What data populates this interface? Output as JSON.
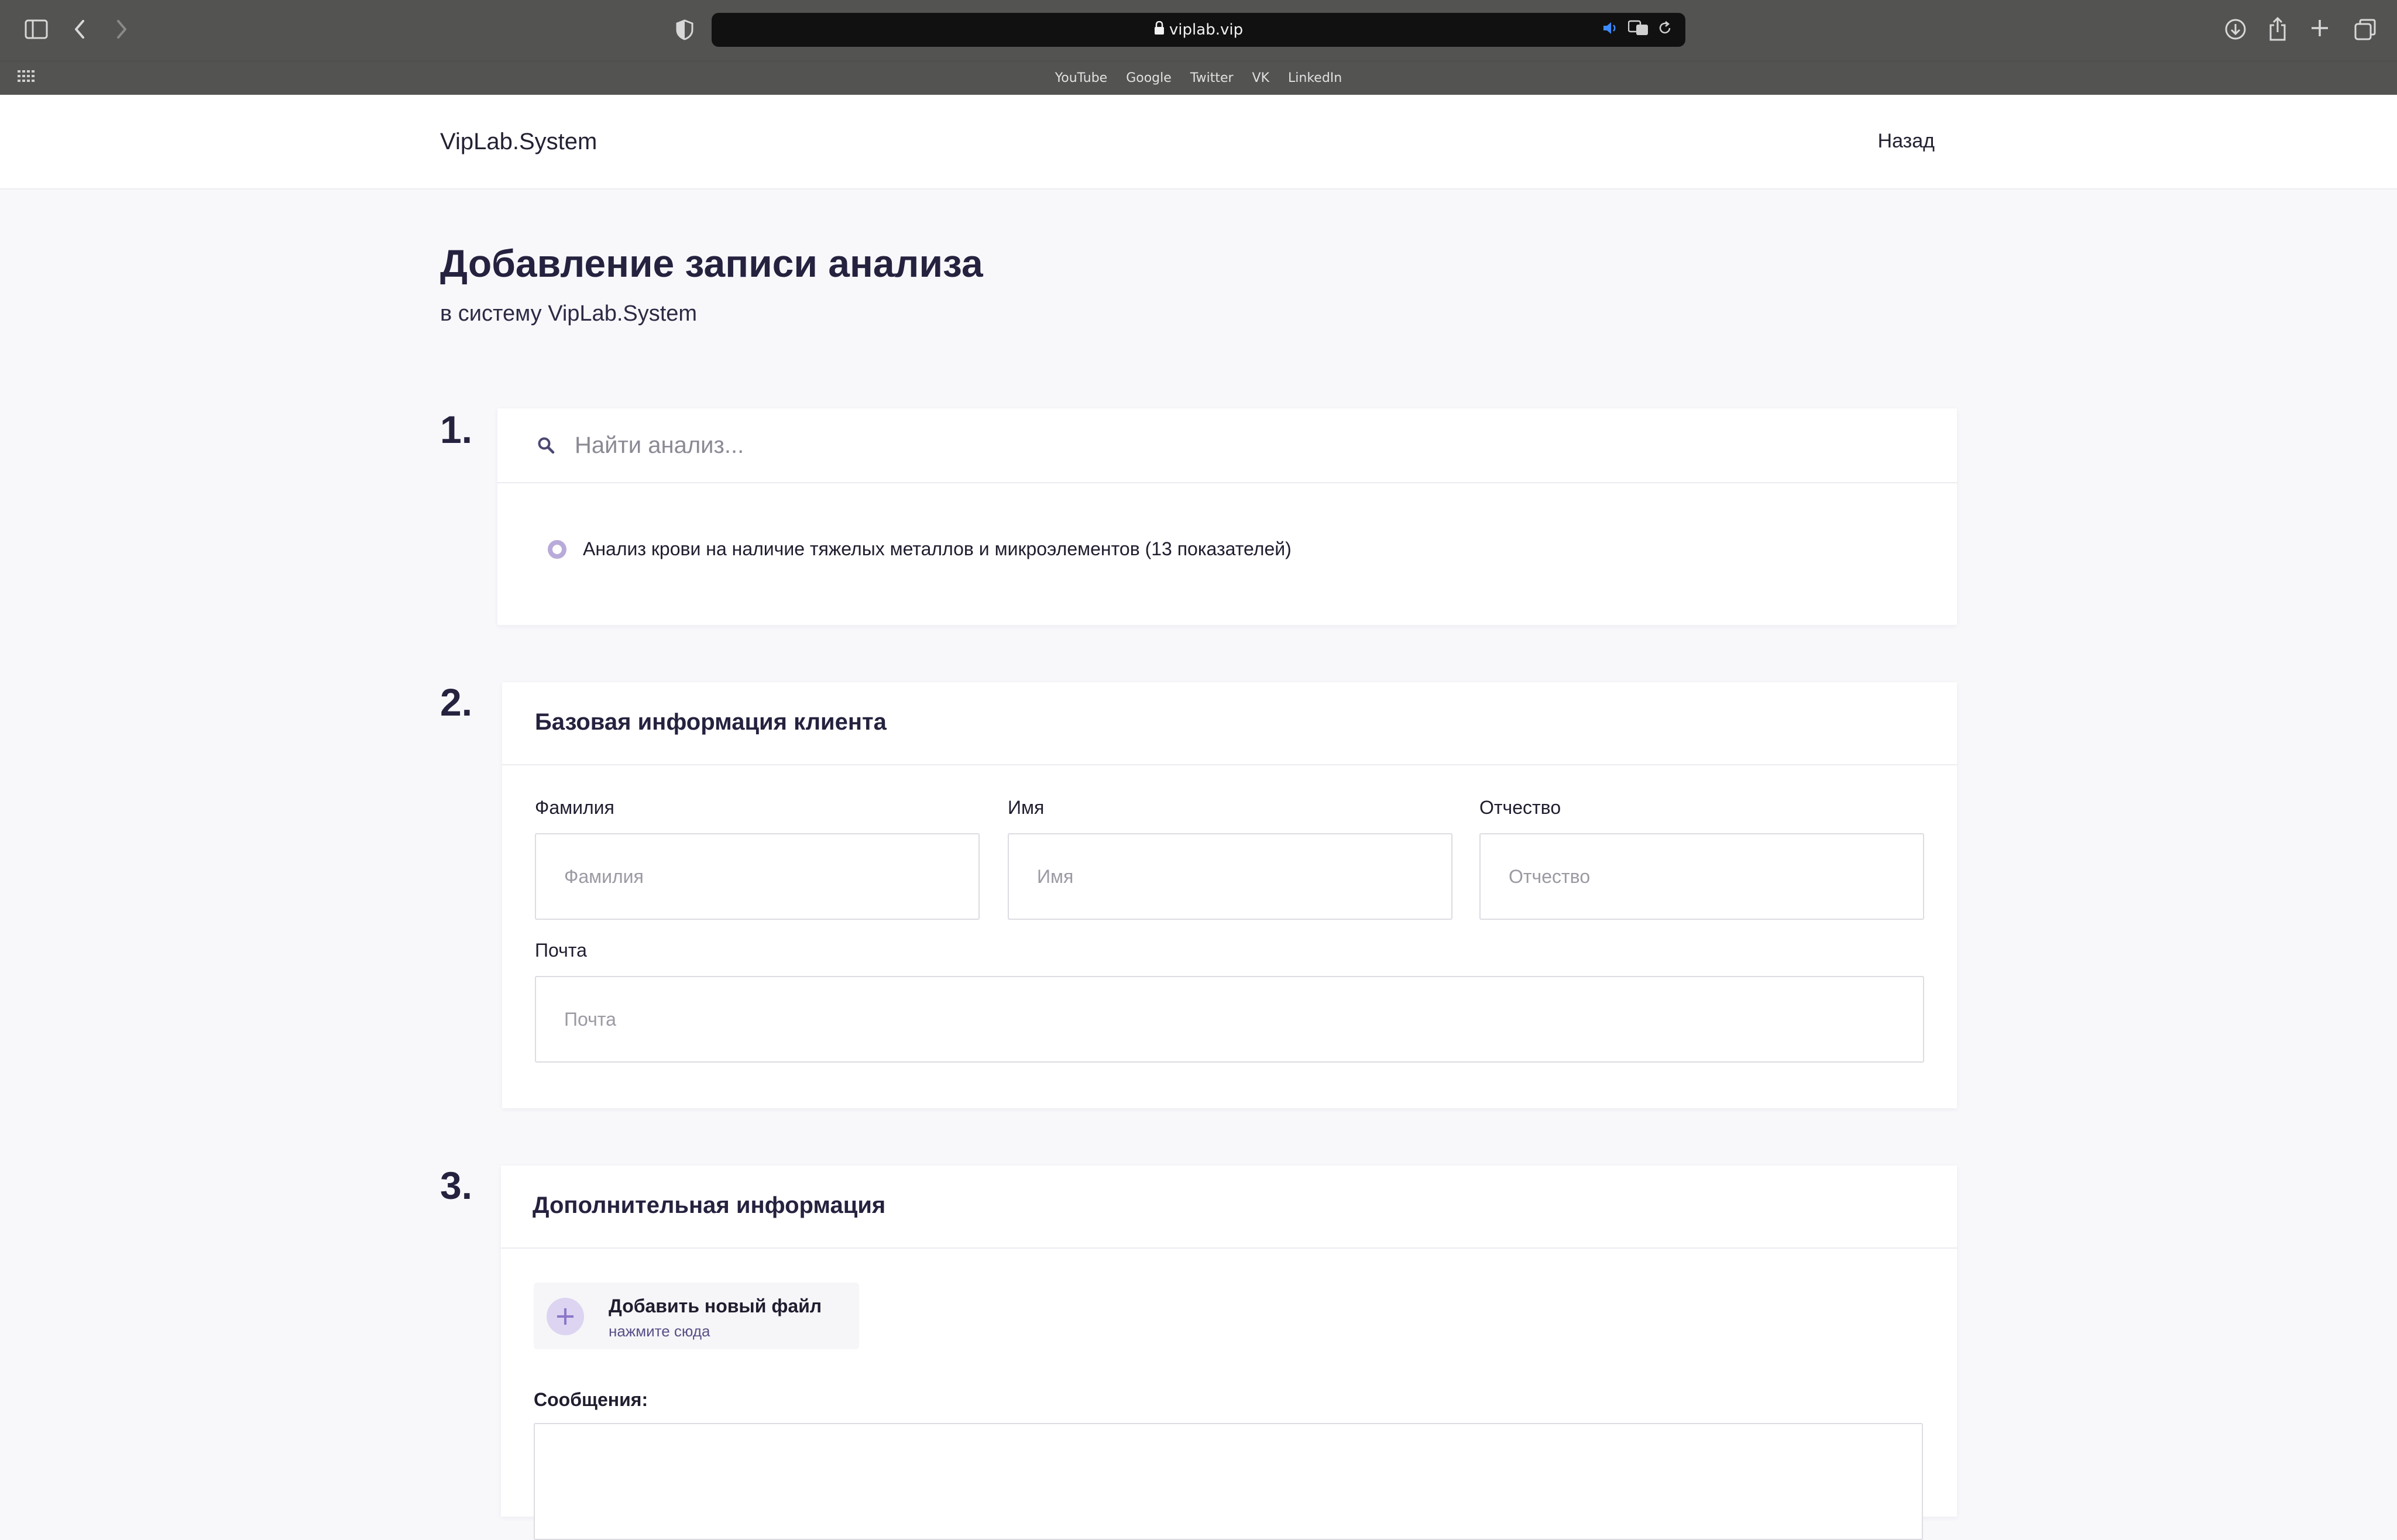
{
  "browser": {
    "url": "viplab.vip",
    "bookmarks": [
      "YouTube",
      "Google",
      "Twitter",
      "VK",
      "LinkedIn"
    ]
  },
  "header": {
    "brand": "VipLab.System",
    "back": "Назад"
  },
  "page": {
    "title": "Добавление записи анализа",
    "subtitle": "в систему VipLab.System"
  },
  "steps": {
    "one": {
      "number": "1.",
      "search_placeholder": "Найти анализ...",
      "options": [
        "Анализ крови на наличие тяжелых металлов и микроэлементов (13 показателей)"
      ]
    },
    "two": {
      "number": "2.",
      "title": "Базовая информация клиента",
      "fields": {
        "last_name": {
          "label": "Фамилия",
          "placeholder": "Фамилия"
        },
        "first_name": {
          "label": "Имя",
          "placeholder": "Имя"
        },
        "patronymic": {
          "label": "Отчество",
          "placeholder": "Отчество"
        },
        "email": {
          "label": "Почта",
          "placeholder": "Почта"
        }
      }
    },
    "three": {
      "number": "3.",
      "title": "Дополнительная информация",
      "add_file_title": "Добавить новый файл",
      "add_file_hint": "нажмите сюда",
      "messages_label": "Сообщения:"
    }
  },
  "colors": {
    "accent": "#b8abd9",
    "accent_bg": "#dcd4f0",
    "heading": "#25223f",
    "page_bg": "#f8f8fb"
  }
}
